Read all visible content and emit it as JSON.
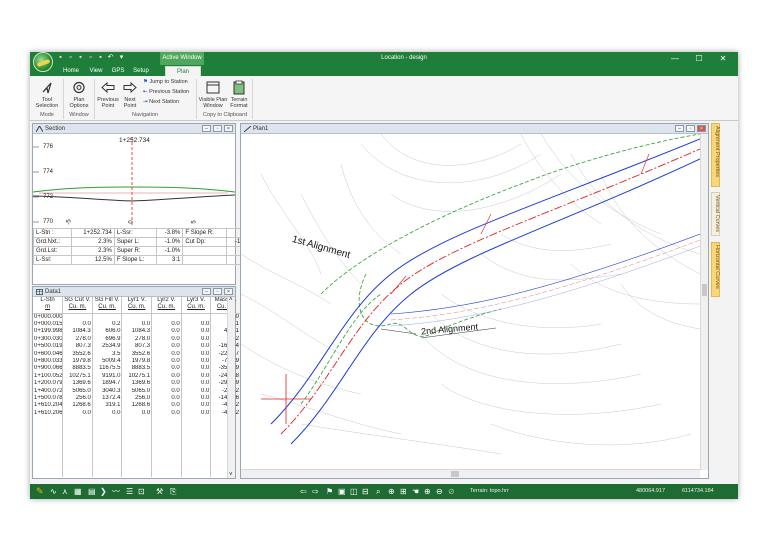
{
  "window": {
    "active_window_label": "Active Window",
    "title": "Location - design",
    "minimize_glyph": "—",
    "maximize_glyph": "☐",
    "close_glyph": "✕"
  },
  "tabs": [
    {
      "label": "Home",
      "active": false
    },
    {
      "label": "View",
      "active": false
    },
    {
      "label": "GPS",
      "active": false
    },
    {
      "label": "Setup",
      "active": false
    },
    {
      "label": "Plan",
      "active": true
    }
  ],
  "ribbon": {
    "tool_selection": "Tool Selection",
    "plan_options": "Plan Options",
    "previous_point": "Previous Point",
    "next_point": "Next Point",
    "jump_to_station": "Jump to Station",
    "previous_station": "Previous Station",
    "next_station": "Next Station",
    "visible_plan_window": "Visible Plan Window",
    "terrain_format": "Terrain Format",
    "groups": {
      "mode": "Mode",
      "window": "Window",
      "navigation": "Navigation",
      "copy_to_clipboard": "Copy to Clipboard"
    }
  },
  "section_panel": {
    "title": "Section",
    "station_label": "1+252.734",
    "y_ticks": [
      "776",
      "774",
      "772",
      "770"
    ],
    "x_ticks": [
      "-5",
      "0",
      "5"
    ],
    "info_rows": [
      [
        "L-Stn :",
        "1+252.734",
        "L-Ssr:",
        "-3.8%",
        "F Slope R:",
        "3:1"
      ],
      [
        "Grd.Nxt.:",
        "2.3%",
        "Super L:",
        "-1.0%",
        "Cut Dp:",
        "-1.242"
      ],
      [
        "Grd.Lst:",
        "2.3%",
        "Super R:",
        "-1.0%",
        "",
        ""
      ],
      [
        "L-Ssl:",
        "12.5%",
        "F Slope L:",
        "3:1",
        "",
        ""
      ]
    ]
  },
  "data_panel": {
    "title": "Data1",
    "columns": [
      {
        "name": "L-Stn",
        "unit": "m"
      },
      {
        "name": "SG Cut V.",
        "unit": "Cu. m."
      },
      {
        "name": "SG Fill V.",
        "unit": "Cu. m."
      },
      {
        "name": "Lyr1 V.",
        "unit": "Cu. m."
      },
      {
        "name": "Lyr2 V.",
        "unit": "Cu. m."
      },
      {
        "name": "Lyr3 V.",
        "unit": "Cu. m."
      },
      {
        "name": "Mass H.",
        "unit": "Cu. m."
      }
    ],
    "rows": [
      [
        "0+000.000",
        "",
        "",
        "",
        "",
        "",
        "0.0"
      ],
      [
        "0+000.015",
        "0.0",
        "0.2",
        "0.0",
        "0.0",
        "0.0",
        "-0.1"
      ],
      [
        "0+199.998",
        "1084.3",
        "606.0",
        "1084.3",
        "0.0",
        "0.0",
        "478.1"
      ],
      [
        "0+300.030",
        "278.0",
        "696.9",
        "278.0",
        "0.0",
        "0.0",
        "69.2"
      ],
      [
        "0+500.019",
        "807.3",
        "2534.9",
        "807.3",
        "0.0",
        "0.0",
        "-1668.4"
      ],
      [
        "0+600.046",
        "3552.6",
        "3.5",
        "3552.6",
        "0.0",
        "0.0",
        "-2280.7"
      ],
      [
        "0+800.033",
        "1979.8",
        "5009.4",
        "1979.8",
        "0.0",
        "0.0",
        "-748.9"
      ],
      [
        "0+900.066",
        "8883.5",
        "11675.5",
        "8883.5",
        "0.0",
        "0.0",
        "-3540.9"
      ],
      [
        "1+100.052",
        "10275.1",
        "9191.0",
        "10275.1",
        "0.0",
        "0.0",
        "-2455.8"
      ],
      [
        "1+200.079",
        "1369.6",
        "1894.7",
        "1369.6",
        "0.0",
        "0.0",
        "-2980.9"
      ],
      [
        "1+400.072",
        "5065.0",
        "3040.3",
        "5065.0",
        "0.0",
        "0.0",
        "-286.2"
      ],
      [
        "1+500.078",
        "256.0",
        "1372.4",
        "256.0",
        "0.0",
        "0.0",
        "-1492.6"
      ],
      [
        "1+610.204",
        "1268.6",
        "319.1",
        "1268.6",
        "0.0",
        "0.0",
        "-453.2"
      ],
      [
        "1+610.206",
        "0.0",
        "0.0",
        "0.0",
        "0.0",
        "0.0",
        "-453.2"
      ]
    ]
  },
  "plan_panel": {
    "title": "Plan1",
    "alignment_1": "1st Alignment",
    "alignment_2": "2nd Alignment"
  },
  "side_tabs": [
    "Alignment Properties",
    "Vertical Curves",
    "Horizontal Curves"
  ],
  "statusbar": {
    "terrain": "Terrain: topo.hrr",
    "coord_x": "480064.917",
    "coord_y": "6114734.184"
  },
  "colors": {
    "title_green": "#1f7e3a",
    "status_green": "#1e6b33",
    "alignment_blue": "#1f3bd9",
    "centerline_red": "#e02020",
    "offset_green": "#2aa02a",
    "side_tab_yellow": "#f7d67c"
  }
}
